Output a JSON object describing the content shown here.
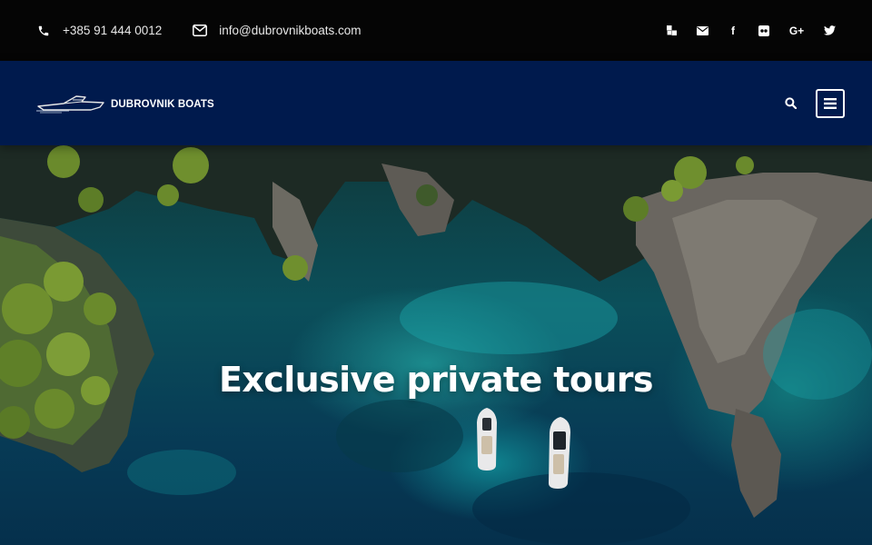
{
  "topbar": {
    "phone": "+385 91 444 0012",
    "email": "info@dubrovnikboats.com",
    "social": [
      {
        "icon": "delicious-icon"
      },
      {
        "icon": "envelope-icon"
      },
      {
        "icon": "facebook-icon",
        "glyph": "f"
      },
      {
        "icon": "flickr-icon"
      },
      {
        "icon": "google-plus-icon",
        "glyph": "G+"
      },
      {
        "icon": "twitter-icon"
      }
    ]
  },
  "navbar": {
    "logo_text": "DUBROVNIK BOATS",
    "background": "#001a4d"
  },
  "hero": {
    "title": "Exclusive private tours"
  },
  "colors": {
    "topbar_bg": "#050505",
    "navbar_bg": "#001a4d",
    "text": "#ffffff"
  }
}
